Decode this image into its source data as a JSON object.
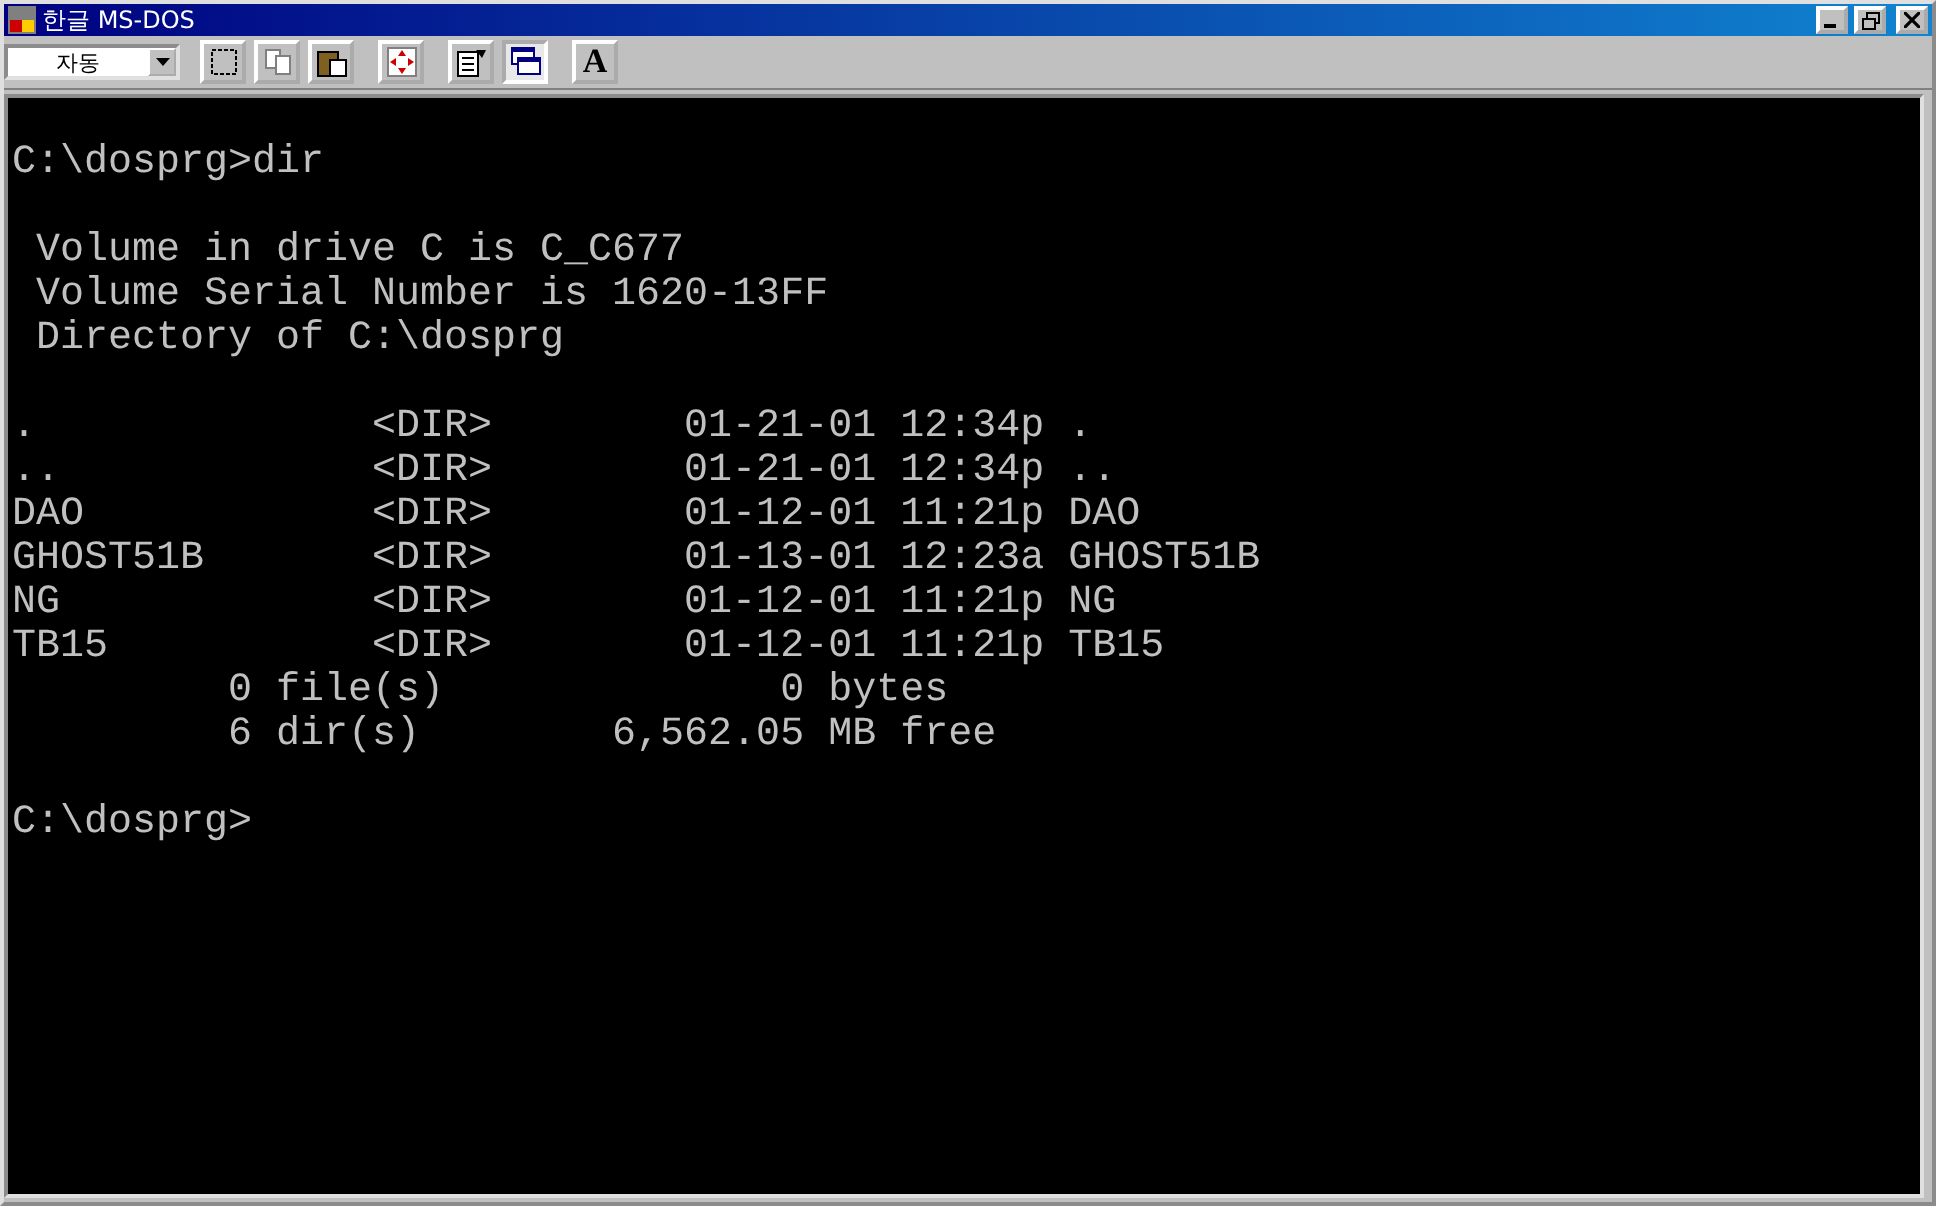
{
  "window": {
    "title": "한글 MS-DOS"
  },
  "toolbar": {
    "font_size": "자동",
    "buttons": [
      {
        "kind": "mark",
        "pressed": false
      },
      {
        "kind": "copy",
        "pressed": false
      },
      {
        "kind": "paste",
        "pressed": false
      },
      {
        "kind": "fullscreen",
        "pressed": false
      },
      {
        "kind": "properties",
        "pressed": false
      },
      {
        "kind": "background",
        "pressed": true
      },
      {
        "kind": "font",
        "label": "A",
        "pressed": false
      }
    ]
  },
  "console": {
    "blocks": [
      [
        "C:\\dosprg>dir"
      ],
      [
        " Volume in drive C is C_C677",
        " Volume Serial Number is 1620-13FF",
        " Directory of C:\\dosprg"
      ],
      [
        ".              <DIR>        01-21-01 12:34p .",
        "..             <DIR>        01-21-01 12:34p ..",
        "DAO            <DIR>        01-12-01 11:21p DAO",
        "GHOST51B       <DIR>        01-13-01 12:23a GHOST51B",
        "NG             <DIR>        01-12-01 11:21p NG",
        "TB15           <DIR>        01-12-01 11:21p TB15",
        "         0 file(s)              0 bytes",
        "         6 dir(s)        6,562.05 MB free"
      ],
      [
        "C:\\dosprg>"
      ]
    ]
  }
}
